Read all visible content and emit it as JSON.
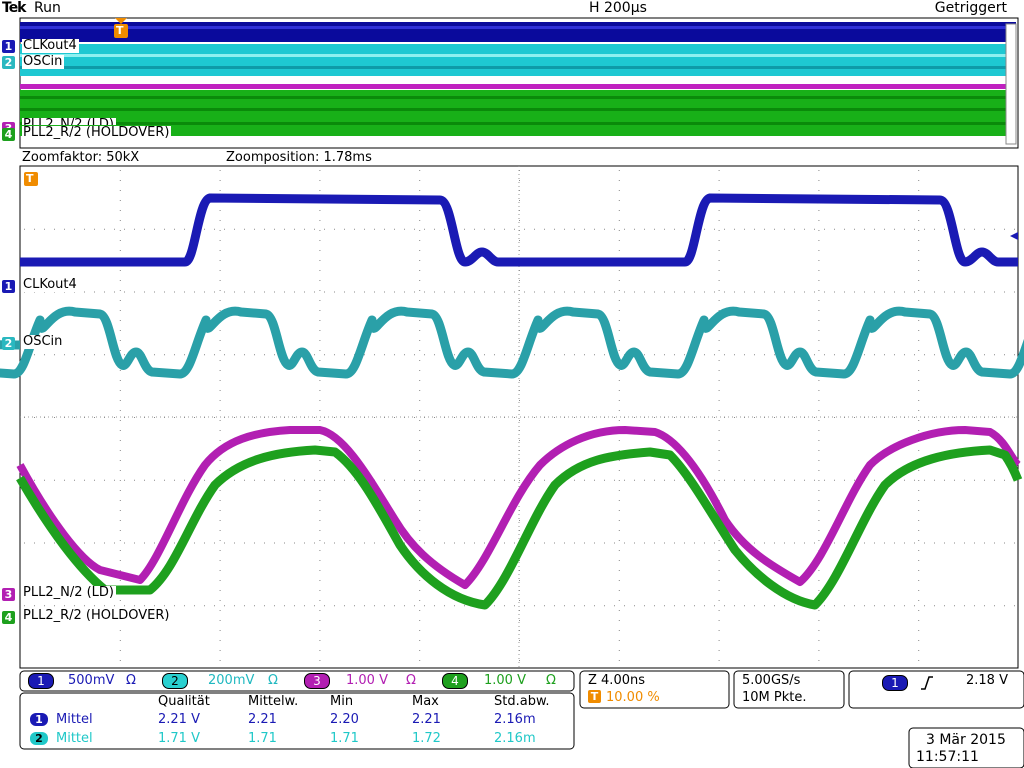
{
  "top_bar": {
    "brand": "Tek",
    "state": "Run",
    "horizontal": "H 200µs",
    "trigger_status": "Getriggert"
  },
  "overview": {
    "ch1_label": "CLKout4",
    "ch2_label": "OSCin",
    "ch3_label": "PLL2_N/2 (LD)",
    "ch4_label": "PLL2_R/2 (HOLDOVER)"
  },
  "zoom": {
    "factor": "Zoomfaktor: 50kX",
    "position": "Zoomposition: 1.78ms"
  },
  "traces": [
    {
      "marker": "1",
      "label": "CLKout4",
      "color": "#1a1ab4"
    },
    {
      "marker": "2",
      "label": "OSCin",
      "color": "#2aa0a8"
    },
    {
      "marker": "3",
      "label": "PLL2_N/2 (LD)",
      "color": "#b21fb2"
    },
    {
      "marker": "4",
      "label": "PLL2_R/2 (HOLDOVER)",
      "color": "#1ea01e"
    }
  ],
  "channel_settings": [
    {
      "num": "1",
      "value": "500mV",
      "ohm": "Ω",
      "color": "#1a1ab4"
    },
    {
      "num": "2",
      "value": "200mV",
      "ohm": "Ω",
      "color": "#2ad0d0"
    },
    {
      "num": "3",
      "value": "1.00 V",
      "ohm": "Ω",
      "color": "#b21fb2"
    },
    {
      "num": "4",
      "value": "1.00 V",
      "ohm": "Ω",
      "color": "#1ea01e"
    }
  ],
  "zoom_scale": {
    "z": "Z 4.00ns",
    "t_percent": "10.00 %"
  },
  "acquisition": {
    "rate": "5.00GS/s",
    "points": "10M Pkte."
  },
  "trigger": {
    "source": "1",
    "slope_icon": "rising-edge-icon",
    "level": "2.18 V"
  },
  "measurements": {
    "headers": [
      "Qualität",
      "Mittelw.",
      "Min",
      "Max",
      "Std.abw."
    ],
    "rows": [
      {
        "ch": "1",
        "name": "Mittel",
        "values": [
          "2.21 V",
          "2.21",
          "2.20",
          "2.21",
          "2.16m"
        ],
        "color": "#1a1ab4"
      },
      {
        "ch": "2",
        "name": "Mittel",
        "values": [
          "1.71 V",
          "1.71",
          "1.71",
          "1.72",
          "2.16m"
        ],
        "color": "#20c8c8"
      }
    ]
  },
  "datetime": {
    "date": "3 Mär 2015",
    "time": "11:57:11"
  }
}
